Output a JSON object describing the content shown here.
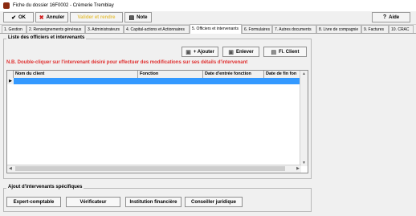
{
  "window": {
    "title": "Fiche du dossier 16F0002 - Crèmerie Tremblay"
  },
  "toolbar": {
    "ok": "OK",
    "annuler": "Annuler",
    "disabled": "Valider et rendre",
    "note": "Note",
    "aide": "Aide"
  },
  "tabs": [
    "1. Gestion",
    "2. Renseignements généraux",
    "3. Administrateurs",
    "4. Capital-actions et Actionnaires",
    "5. Officiers et intervenants",
    "6. Formulaires",
    "7. Autres documents",
    "8. Livre de compagnie",
    "9. Factures",
    "10. CRAC"
  ],
  "officers": {
    "title": "Liste des officiers et intervenants",
    "add": "+ Ajouter",
    "remove": "Enlever",
    "fiche": "Fi. Client",
    "note": "N.B. Double-cliquer sur l'intervenant désiré pour effectuer des modifications sur ses détails d'intervenant",
    "columns": [
      "Nom du client",
      "Fonction",
      "Date d'entrée fonction",
      "Date de fin fon"
    ]
  },
  "special": {
    "title": "Ajout d'intervenants spécifiques",
    "buttons": [
      "Expert-comptable",
      "Vérificateur",
      "Institution financière",
      "Conseiller juridique"
    ]
  }
}
